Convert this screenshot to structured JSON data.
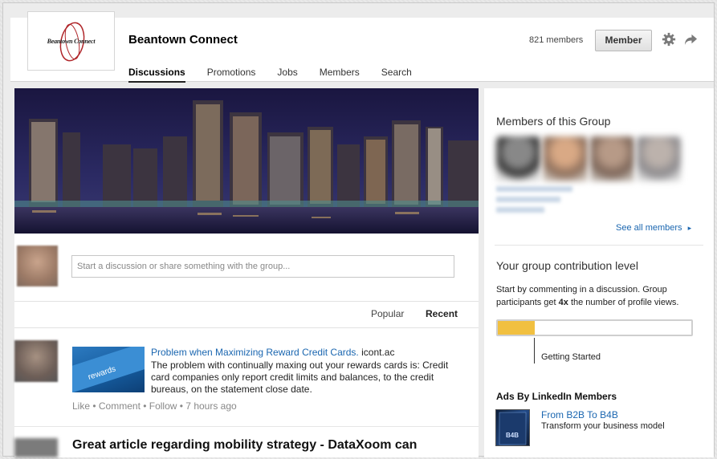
{
  "group": {
    "logo_text": "Beantown Connect",
    "title": "Beantown Connect",
    "members_count": "821 members",
    "member_button": "Member"
  },
  "tabs": [
    {
      "label": "Discussions",
      "active": true
    },
    {
      "label": "Promotions"
    },
    {
      "label": "Jobs"
    },
    {
      "label": "Members"
    },
    {
      "label": "Search"
    }
  ],
  "composer": {
    "placeholder": "Start a discussion or share something with the group..."
  },
  "sort": {
    "popular": "Popular",
    "recent": "Recent"
  },
  "posts": [
    {
      "title": "Problem when Maximizing Reward Credit Cards.",
      "source": " icont.ac",
      "body": "The problem with continually maxing out your rewards cards is: Credit card companies only report credit limits and balances, to the credit bureaus, on the statement close date.",
      "actions": "Like • Comment • Follow • 7 hours ago",
      "thumb_text": "rewards"
    },
    {
      "title": "Great article regarding mobility strategy - DataXoom can"
    }
  ],
  "sidebar": {
    "members_heading": "Members of this Group",
    "see_all": "See all members",
    "contribution_heading": "Your group contribution level",
    "contribution_text_1": "Start by commenting in a discussion. Group participants get ",
    "contribution_bold": "4x",
    "contribution_text_2": " the number of profile views.",
    "contribution_progress": 0.19,
    "progress_label": "Getting Started",
    "ads_heading": "Ads By LinkedIn Members",
    "ad_title": "From B2B To B4B",
    "ad_desc": "Transform your business model",
    "ad_book_text": "B4B"
  },
  "colors": {
    "link": "#1a66b0",
    "progress_fill": "#f1c040",
    "logo_accent": "#b0262a"
  },
  "icons": [
    "gear-icon",
    "share-arrow-icon",
    "chevron-right-icon"
  ]
}
